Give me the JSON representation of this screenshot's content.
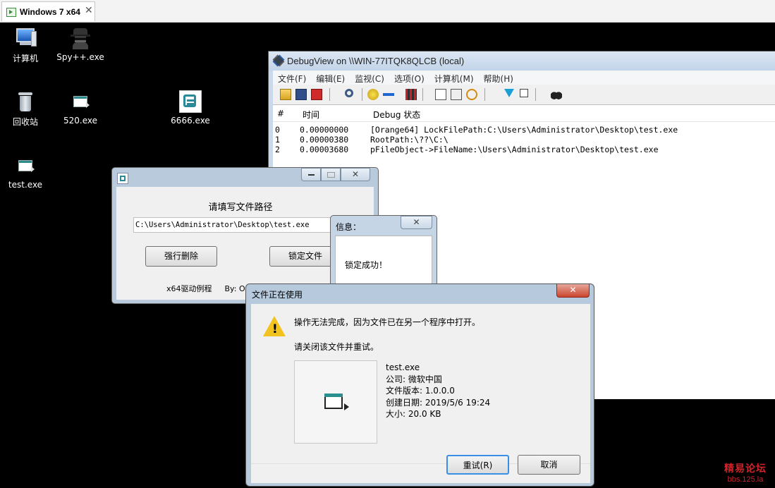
{
  "vm_tab": {
    "title": "Windows 7 x64",
    "close": "✕"
  },
  "desktop": {
    "icons": [
      {
        "label": "计算机",
        "icon": "computer-icon"
      },
      {
        "label": "Spy++.exe",
        "icon": "spy-icon"
      },
      {
        "label": "回收站",
        "icon": "recycle-bin-icon"
      },
      {
        "label": "520.exe",
        "icon": "exe-icon"
      },
      {
        "label": "6666.exe",
        "icon": "app-icon"
      },
      {
        "label": "test.exe",
        "icon": "exe-icon"
      }
    ]
  },
  "debugview": {
    "title": "DebugView on \\\\WIN-77ITQK8QLCB (local)",
    "menu": [
      "文件(F)",
      "编辑(E)",
      "监视(C)",
      "选项(O)",
      "计算机(M)",
      "帮助(H)"
    ],
    "columns": [
      "#",
      "时间",
      "Debug 状态"
    ],
    "rows": [
      {
        "num": "0",
        "time": "0.00000000",
        "msg": "[Orange64] LockFilePath:C:\\Users\\Administrator\\Desktop\\test.exe"
      },
      {
        "num": "1",
        "time": "0.00000380",
        "msg": "RootPath:\\??\\C:\\"
      },
      {
        "num": "2",
        "time": "0.00003680",
        "msg": "pFileObject->FileName:\\Users\\Administrator\\Desktop\\test.exe"
      }
    ]
  },
  "tool_window": {
    "prompt": "请填写文件路径",
    "path_value": "C:\\Users\\Administrator\\Desktop\\test.exe",
    "force_delete": "强行删除",
    "lock_file": "锁定文件",
    "footer": "x64驱动例程",
    "by": "By: O"
  },
  "info_box": {
    "title": "信息：",
    "message": "锁定成功！",
    "close": "✕"
  },
  "file_in_use": {
    "title": "文件正在使用",
    "close": "✕",
    "line1": "操作无法完成，因为文件已在另一个程序中打开。",
    "line2": "请关闭该文件并重试。",
    "file": {
      "name": "test.exe",
      "company": "公司: 微软中国",
      "version": "文件版本: 1.0.0.0",
      "created": "创建日期: 2019/5/6 19:24",
      "size": "大小: 20.0 KB"
    },
    "retry": "重试(R)",
    "cancel": "取消"
  },
  "watermark": {
    "line1": "精易论坛",
    "line2": "bbs.125.la"
  }
}
